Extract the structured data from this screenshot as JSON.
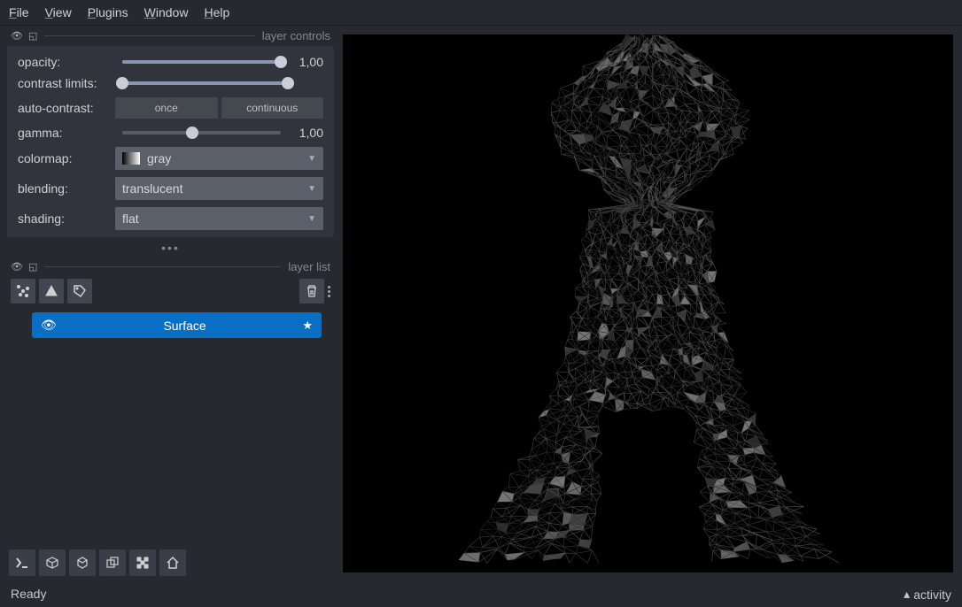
{
  "menu": {
    "file": "File",
    "view": "View",
    "plugins": "Plugins",
    "window": "Window",
    "help": "Help"
  },
  "panels": {
    "layer_controls": "layer controls",
    "layer_list": "layer list"
  },
  "controls": {
    "opacity": {
      "label": "opacity:",
      "value": "1,00",
      "percent": 100
    },
    "contrast_limits": {
      "label": "contrast limits:",
      "low": 0,
      "high": 100
    },
    "auto_contrast": {
      "label": "auto-contrast:",
      "once": "once",
      "continuous": "continuous"
    },
    "gamma": {
      "label": "gamma:",
      "value": "1,00",
      "percent": 44
    },
    "colormap": {
      "label": "colormap:",
      "value": "gray"
    },
    "blending": {
      "label": "blending:",
      "value": "translucent"
    },
    "shading": {
      "label": "shading:",
      "value": "flat"
    }
  },
  "layer": {
    "name": "Surface"
  },
  "status": {
    "left": "Ready",
    "right": "activity"
  },
  "icons": {
    "points": "points-icon",
    "labels": "labels-icon",
    "shapes": "shapes-icon",
    "delete": "delete-icon"
  }
}
